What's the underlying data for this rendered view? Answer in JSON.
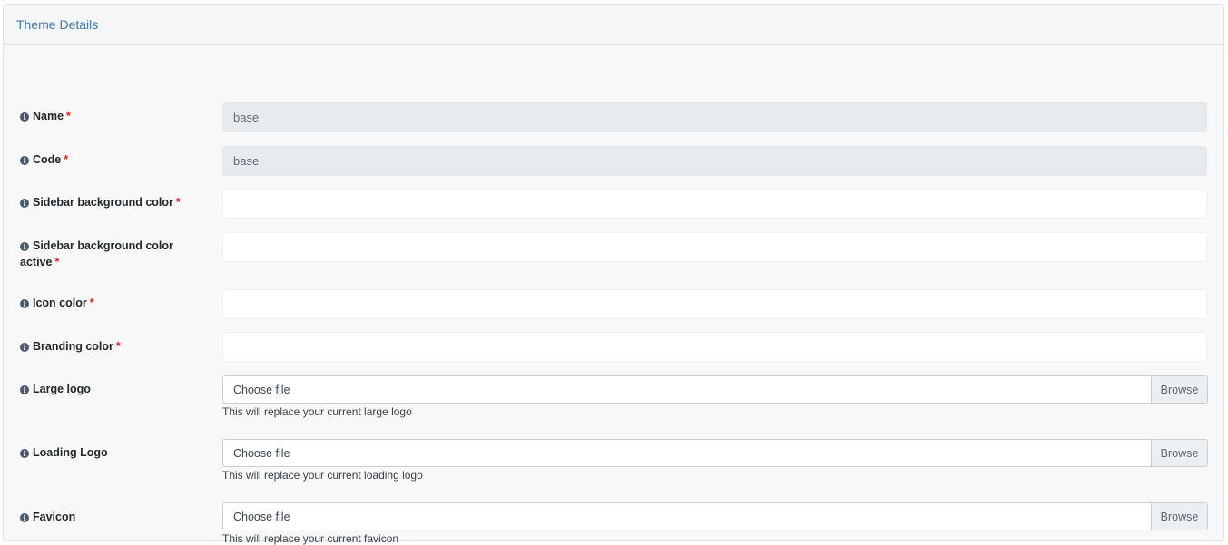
{
  "card": {
    "title": "Theme Details"
  },
  "fields": {
    "name": {
      "label": "Name",
      "required": "*",
      "value": "base"
    },
    "code": {
      "label": "Code",
      "required": "*",
      "value": "base"
    },
    "sidebar_bg": {
      "label": "Sidebar background color",
      "required": "*",
      "value": ""
    },
    "sidebar_bg_active": {
      "label_line1": "Sidebar background color",
      "label_line2": "active",
      "required": "*",
      "value": ""
    },
    "icon_color": {
      "label": "Icon color",
      "required": "*",
      "value": ""
    },
    "branding_color": {
      "label": "Branding color",
      "required": "*",
      "value": ""
    },
    "large_logo": {
      "label": "Large logo",
      "file_text": "Choose file",
      "browse": "Browse",
      "help": "This will replace your current large logo"
    },
    "loading_logo": {
      "label": "Loading Logo",
      "file_text": "Choose file",
      "browse": "Browse",
      "help": "This will replace your current loading logo"
    },
    "favicon": {
      "label": "Favicon",
      "file_text": "Choose file",
      "browse": "Browse",
      "help": "This will replace your current favicon"
    }
  },
  "icons": {
    "info": "info-circle-icon",
    "info_glyph": "i"
  },
  "colors": {
    "title": "#4178b4",
    "required": "#e02020",
    "readonly_bg": "#e8ebee"
  }
}
